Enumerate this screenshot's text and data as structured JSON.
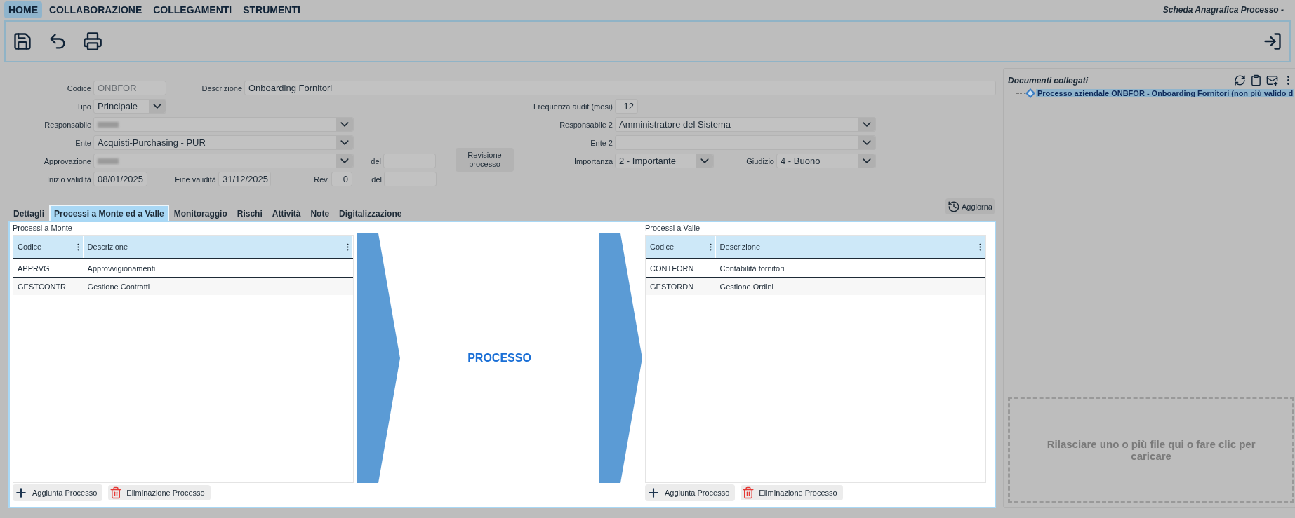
{
  "menu": [
    {
      "label": "HOME",
      "selected": true
    },
    {
      "label": "COLLABORAZIONE",
      "selected": false
    },
    {
      "label": "COLLEGAMENTI",
      "selected": false
    },
    {
      "label": "STRUMENTI",
      "selected": false
    }
  ],
  "page_title": "Scheda Anagrafica Processo -",
  "form": {
    "codice": {
      "label": "Codice",
      "value": "ONBFOR",
      "disabled": true
    },
    "descrizione": {
      "label": "Descrizione",
      "value": "Onboarding Fornitori"
    },
    "tipo": {
      "label": "Tipo",
      "value": "Principale"
    },
    "frequenza": {
      "label": "Frequenza audit (mesi)",
      "value": "12"
    },
    "responsabile": {
      "label": "Responsabile",
      "redacted": true
    },
    "responsabile2": {
      "label": "Responsabile 2",
      "value": "Amministratore del Sistema"
    },
    "ente": {
      "label": "Ente",
      "value": "Acquisti-Purchasing - PUR"
    },
    "ente2": {
      "label": "Ente 2"
    },
    "approvazione": {
      "label": "Approvazione",
      "redacted": true
    },
    "del_approvazione": {
      "label": "del"
    },
    "importanza": {
      "label": "Importanza",
      "value": "2 - Importante"
    },
    "giudizio": {
      "label": "Giudizio",
      "value": "4 - Buono"
    },
    "inizio": {
      "label": "Inizio validità",
      "value": "08/01/2025"
    },
    "fine": {
      "label": "Fine validità",
      "value": "31/12/2025"
    },
    "rev": {
      "label": "Rev.",
      "value": "0"
    },
    "del_rev": {
      "label": "del"
    },
    "revisione_button": "Revisione processo"
  },
  "refresh_button": "Aggiorna",
  "tabs": [
    {
      "label": "Dettagli",
      "selected": false
    },
    {
      "label": "Processi a Monte ed a Valle",
      "selected": true
    },
    {
      "label": "Monitoraggio",
      "selected": false
    },
    {
      "label": "Rischi",
      "selected": false
    },
    {
      "label": "Attività",
      "selected": false
    },
    {
      "label": "Note",
      "selected": false
    },
    {
      "label": "Digitalizzazione",
      "selected": false
    }
  ],
  "upstream": {
    "title": "Processi a Monte",
    "columns": [
      "Codice",
      "Descrizione"
    ],
    "rows": [
      [
        "APPRVG",
        "Approvvigionamenti"
      ],
      [
        "GESTCONTR",
        "Gestione Contratti"
      ]
    ],
    "add_button": "Aggiunta Processo",
    "delete_button": "Eliminazione Processo"
  },
  "center_label": "PROCESSO",
  "downstream": {
    "title": "Processi a Valle",
    "columns": [
      "Codice",
      "Descrizione"
    ],
    "rows": [
      [
        "CONTFORN",
        "Contabilità fornitori"
      ],
      [
        "GESTORDN",
        "Gestione Ordini"
      ]
    ],
    "add_button": "Aggiunta Processo",
    "delete_button": "Eliminazione Processo"
  },
  "documents": {
    "title": "Documenti collegati",
    "items": [
      {
        "label": "Processo aziendale ONBFOR - Onboarding Fornitori (non più valido d",
        "selected": true
      }
    ],
    "dropzone": "Rilasciare uno o più file qui o fare clic per caricare"
  }
}
